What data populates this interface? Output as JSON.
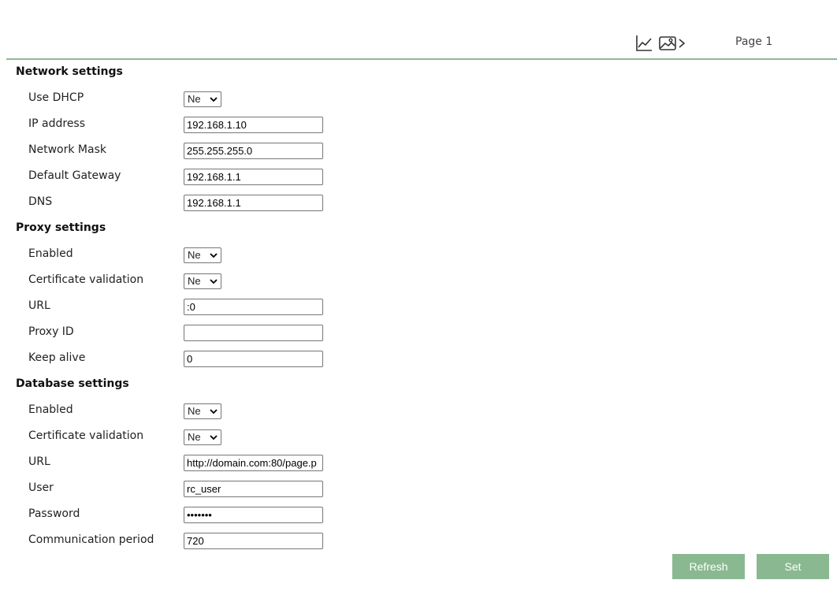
{
  "header": {
    "chart_icon": "line-chart-icon",
    "image_icon": "image-forward-icon",
    "page_label": "Page 1"
  },
  "network": {
    "title": "Network settings",
    "use_dhcp_label": "Use DHCP",
    "use_dhcp_value": "Ne",
    "ip_label": "IP address",
    "ip_value": "192.168.1.10",
    "mask_label": "Network Mask",
    "mask_value": "255.255.255.0",
    "gateway_label": "Default Gateway",
    "gateway_value": "192.168.1.1",
    "dns_label": "DNS",
    "dns_value": "192.168.1.1"
  },
  "proxy": {
    "title": "Proxy settings",
    "enabled_label": "Enabled",
    "enabled_value": "Ne",
    "cert_label": "Certificate validation",
    "cert_value": "Ne",
    "url_label": "URL",
    "url_value": ":0",
    "id_label": "Proxy ID",
    "id_value": "",
    "keepalive_label": "Keep alive",
    "keepalive_value": "0"
  },
  "database": {
    "title": "Database settings",
    "enabled_label": "Enabled",
    "enabled_value": "Ne",
    "cert_label": "Certificate validation",
    "cert_value": "Ne",
    "url_label": "URL",
    "url_value": "http://domain.com:80/page.p",
    "user_label": "User",
    "user_value": "rc_user",
    "password_label": "Password",
    "password_value": "•••••••",
    "period_label": "Communication period",
    "period_value": "720"
  },
  "actions": {
    "refresh_label": "Refresh",
    "set_label": "Set"
  },
  "colors": {
    "accent": "#8ab991",
    "divider": "#8fb894"
  }
}
